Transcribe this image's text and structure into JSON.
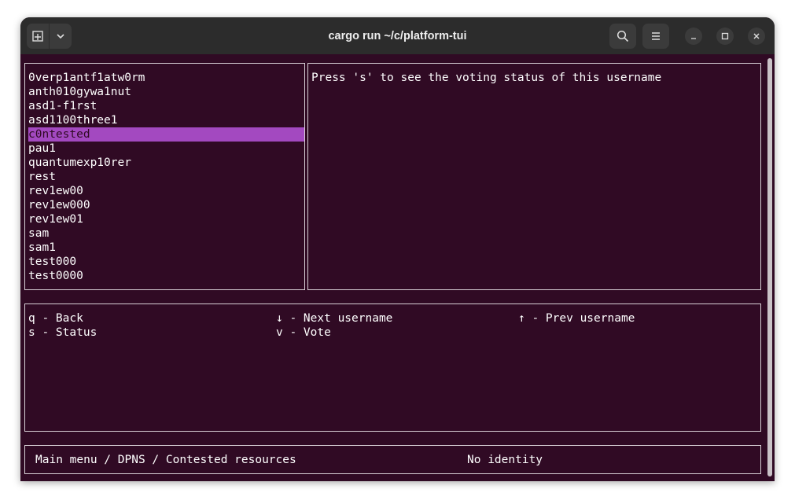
{
  "window": {
    "title": "cargo run ~/c/platform-tui"
  },
  "titlebar_icons": {
    "new_tab": "new-tab-icon",
    "dropdown": "chevron-down-icon",
    "search": "search-icon",
    "menu": "hamburger-menu-icon",
    "minimize": "minimize-icon",
    "maximize": "maximize-icon",
    "close": "close-icon"
  },
  "usernames": {
    "items": [
      "0verp1antf1atw0rm",
      "anth010gywa1nut",
      "asd1-f1rst",
      "asd1100three1",
      "c0ntested",
      "pau1",
      "quantumexp10rer",
      "rest",
      "rev1ew00",
      "rev1ew000",
      "rev1ew01",
      "sam",
      "sam1",
      "test000",
      "test0000"
    ],
    "selected_index": 4
  },
  "info": {
    "message": "Press 's' to see the voting status of this username"
  },
  "keys": {
    "back": "q - Back",
    "status": "s - Status",
    "next": "↓ - Next username",
    "vote": "v - Vote",
    "prev": "↑ - Prev username"
  },
  "statusbar": {
    "breadcrumb": "Main menu / DPNS / Contested resources",
    "identity": "No identity"
  },
  "colors": {
    "terminal_bg": "#300a24",
    "selection": "#a349c0",
    "titlebar": "#2c2c2c",
    "border": "#d8d0d6"
  }
}
